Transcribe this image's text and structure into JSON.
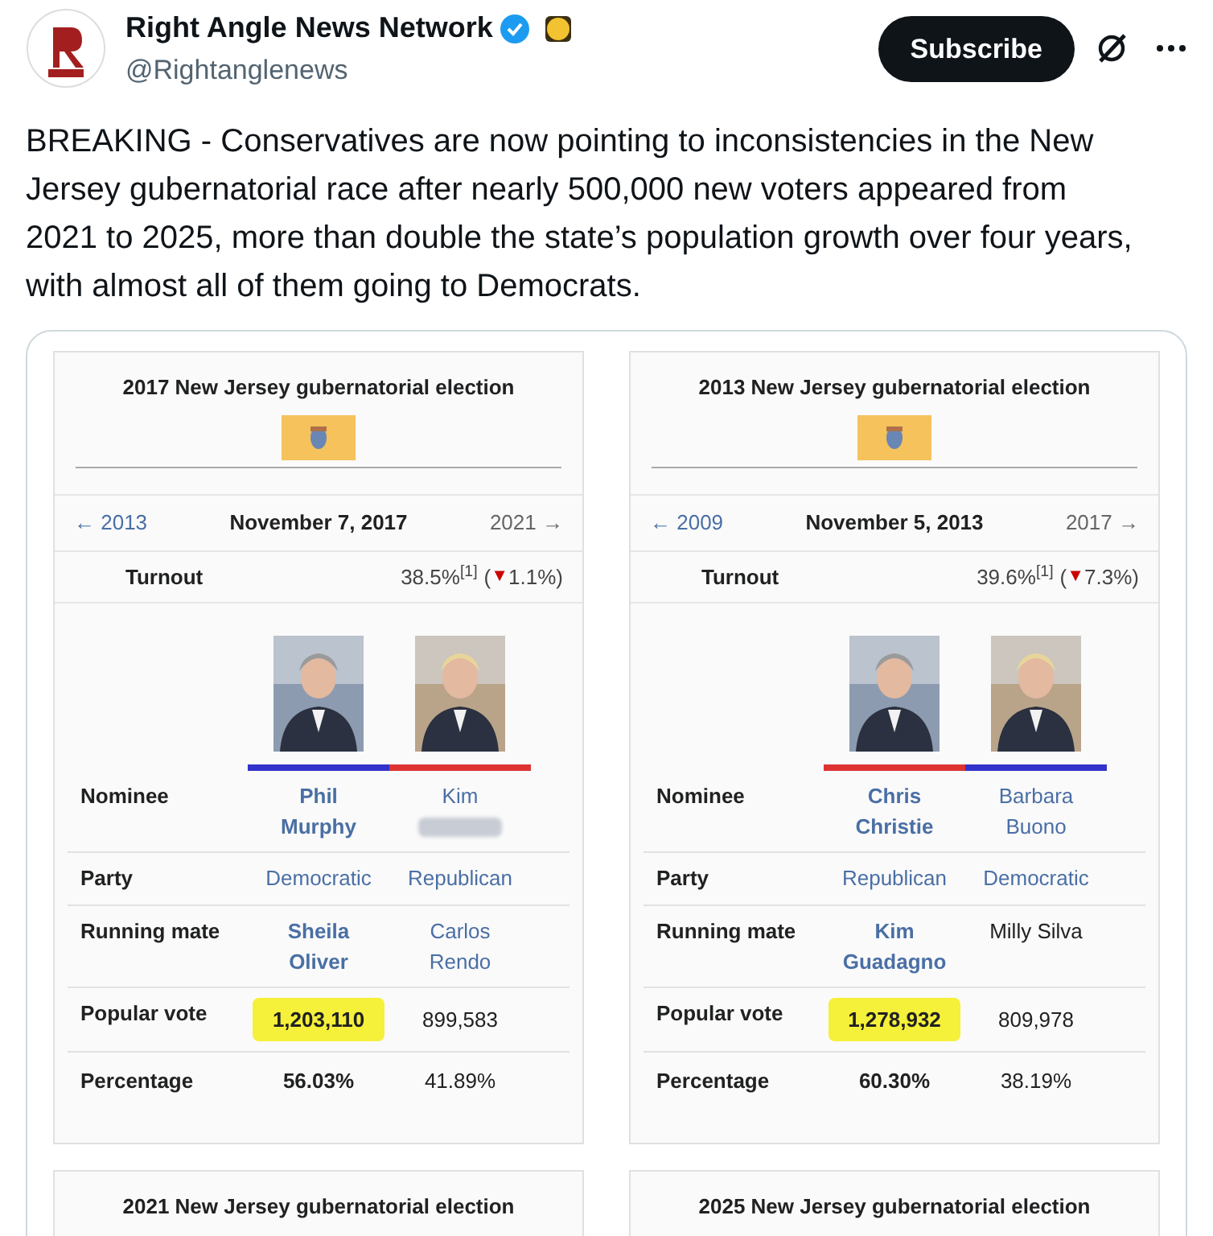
{
  "account": {
    "name": "Right Angle News Network",
    "handle": "@Rightanglenews",
    "verified": true
  },
  "subscribe_button": "Subscribe",
  "tweet_text": "BREAKING - Conservatives are now pointing to inconsistencies in the New Jersey gubernatorial race after nearly 500,000 new voters appeared from 2021 to 2025, more than double the state’s population growth over four years, with almost all of them going to Democrats.",
  "infoboxes": [
    {
      "title": "2017 New Jersey gubernatorial election",
      "prev": "← 2013",
      "date": "November 7, 2017",
      "next": "2021 →",
      "turnout_label": "Turnout",
      "turnout": "38.5%$^{[1]}$",
      "turnout_open": "(",
      "turnout_trend": "▼",
      "turnout_change": "1.1%)",
      "labels": [
        "Nominee",
        "Party",
        "Running mate",
        "Popular vote",
        "Percentage"
      ],
      "candidates": [
        {
          "color": "#3333cc",
          "name": "Phil Murphy",
          "name_redacted": false,
          "winner": true,
          "party": "Democratic",
          "running_mate": "Sheila Oliver",
          "running_mate_linked": true,
          "vote": "1,203,110",
          "highlighted": true,
          "percentage": "56.03%"
        },
        {
          "color": "#dd3333",
          "name": "Kim",
          "name_redacted": true,
          "winner": false,
          "party": "Republican",
          "running_mate": "Carlos Rendo",
          "running_mate_linked": true,
          "vote": "899,583",
          "highlighted": false,
          "percentage": "41.89%"
        }
      ]
    },
    {
      "title": "2013 New Jersey gubernatorial election",
      "prev": "← 2009",
      "date": "November 5, 2013",
      "next": "2017 →",
      "turnout_label": "Turnout",
      "turnout": "39.6%$^{[1]}$",
      "turnout_open": "(",
      "turnout_trend": "▼",
      "turnout_change": "7.3%)",
      "labels": [
        "Nominee",
        "Party",
        "Running mate",
        "Popular vote",
        "Percentage"
      ],
      "candidates": [
        {
          "color": "#dd3333",
          "name": "Chris Christie",
          "name_redacted": false,
          "winner": true,
          "party": "Republican",
          "running_mate": "Kim Guadagno",
          "running_mate_linked": true,
          "vote": "1,278,932",
          "highlighted": true,
          "percentage": "60.30%"
        },
        {
          "color": "#3333cc",
          "name": "Barbara Buono",
          "name_redacted": false,
          "winner": false,
          "party": "Democratic",
          "running_mate": "Milly Silva",
          "running_mate_linked": false,
          "vote": "809,978",
          "highlighted": false,
          "percentage": "38.19%"
        }
      ]
    }
  ],
  "more_infoboxes": [
    {
      "title": "2021 New Jersey gubernatorial election"
    },
    {
      "title": "2025 New Jersey gubernatorial election"
    }
  ]
}
